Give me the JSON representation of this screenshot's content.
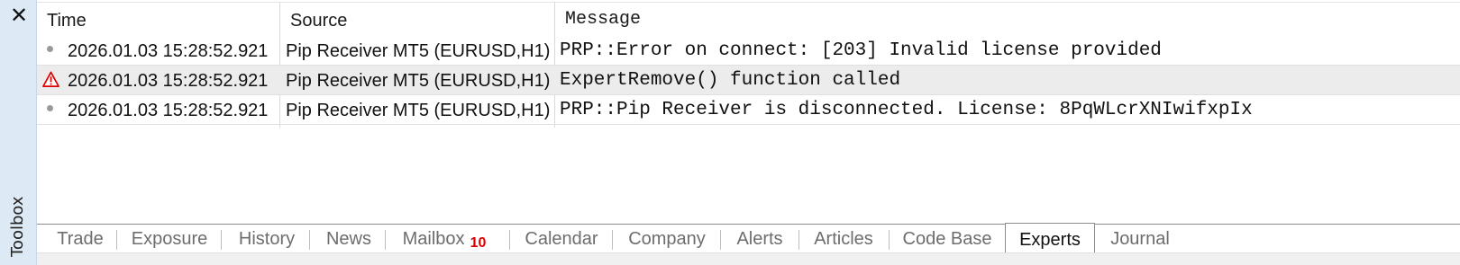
{
  "sidebar": {
    "close_glyph": "✕",
    "label": "Toolbox"
  },
  "table": {
    "columns": [
      "Time",
      "Source",
      "Message"
    ],
    "rows": [
      {
        "icon": "bullet-icon",
        "time": "2026.01.03 15:28:52.921",
        "source": "Pip Receiver MT5 (EURUSD,H1)",
        "message": "PRP::Error on connect: [203] Invalid license provided"
      },
      {
        "icon": "warning-icon",
        "time": "2026.01.03 15:28:52.921",
        "source": "Pip Receiver MT5 (EURUSD,H1)",
        "message": "ExpertRemove() function called"
      },
      {
        "icon": "bullet-icon",
        "time": "2026.01.03 15:28:52.921",
        "source": "Pip Receiver MT5 (EURUSD,H1)",
        "message": "PRP::Pip Receiver is disconnected. License: 8PqWLcrXNIwifxpIx"
      }
    ]
  },
  "tabs": [
    {
      "label": "Trade"
    },
    {
      "label": "Exposure"
    },
    {
      "label": "History"
    },
    {
      "label": "News"
    },
    {
      "label": "Mailbox",
      "badge": "10"
    },
    {
      "label": "Calendar"
    },
    {
      "label": "Company"
    },
    {
      "label": "Alerts"
    },
    {
      "label": "Articles"
    },
    {
      "label": "Code Base"
    },
    {
      "label": "Experts",
      "active": true
    },
    {
      "label": "Journal"
    }
  ],
  "colors": {
    "sidebar_bg": "#dde9f5",
    "selected_row_bg": "#ececec",
    "warning_red": "#e00000",
    "inactive_tab_text": "#6d6d6d"
  }
}
